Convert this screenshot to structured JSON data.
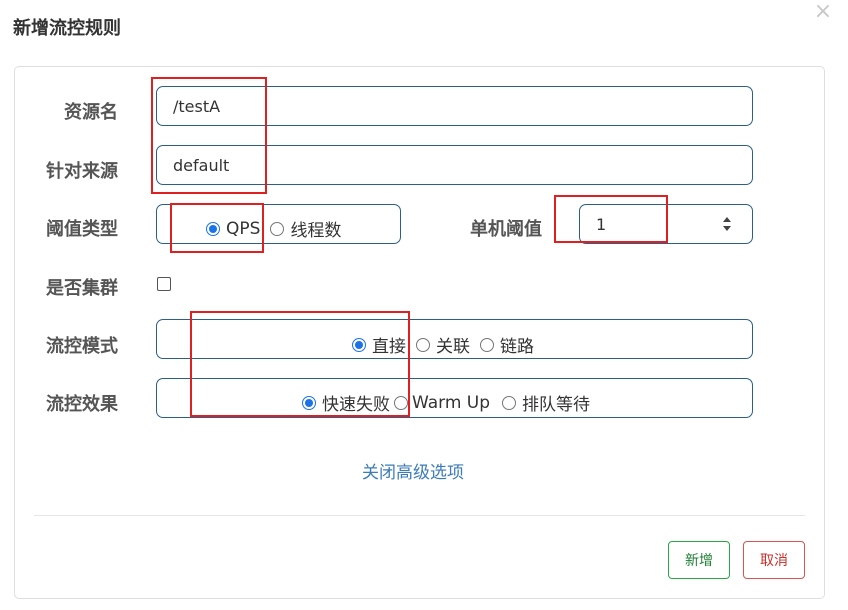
{
  "dialog": {
    "title": "新增流控规则",
    "close_glyph": "×"
  },
  "form": {
    "resource": {
      "label": "资源名",
      "value": "/testA"
    },
    "limit_app": {
      "label": "针对来源",
      "value": "default"
    },
    "threshold_type": {
      "label": "阈值类型",
      "options": [
        {
          "label": "QPS",
          "checked": true
        },
        {
          "label": "线程数",
          "checked": false
        }
      ]
    },
    "single_threshold": {
      "label": "单机阈值",
      "value": "1"
    },
    "cluster": {
      "label": "是否集群",
      "checked": false
    },
    "flow_mode": {
      "label": "流控模式",
      "options": [
        {
          "label": "直接",
          "checked": true
        },
        {
          "label": "关联",
          "checked": false
        },
        {
          "label": "链路",
          "checked": false
        }
      ]
    },
    "flow_effect": {
      "label": "流控效果",
      "options": [
        {
          "label": "快速失败",
          "checked": true
        },
        {
          "label": "Warm Up",
          "checked": false
        },
        {
          "label": "排队等待",
          "checked": false
        }
      ]
    },
    "advanced_link": "关闭高级选项"
  },
  "footer": {
    "add_label": "新增",
    "cancel_label": "取消"
  },
  "colors": {
    "accent": "#1a73e8",
    "input_border": "#2b5f8a",
    "link": "#3a7cb8",
    "add_button": "#29a745",
    "cancel_button": "#d9534f",
    "annotation": "#e02020"
  },
  "icons": {
    "close": "close-icon",
    "spinner": "spinner-arrows-icon"
  }
}
